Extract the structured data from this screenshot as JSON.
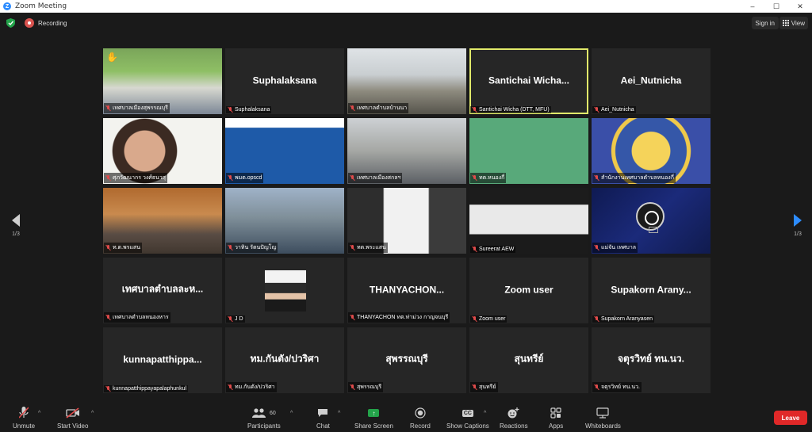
{
  "window": {
    "title": "Zoom Meeting",
    "minimize": "–",
    "maximize": "☐",
    "close": "✕"
  },
  "header": {
    "recording_label": "Recording",
    "signin_label": "Sign in",
    "view_label": "View"
  },
  "pagination": {
    "prev_page": "1/3",
    "next_page": "1/3"
  },
  "participants": [
    {
      "name": "",
      "label": "เทศบาลเมืองสุพรรณบุรี",
      "video": "vid-room1",
      "hand": "✋"
    },
    {
      "name": "Suphalaksana",
      "label": "Suphalaksana",
      "video": ""
    },
    {
      "name": "",
      "label": "เทศบาลตำบลบ้านนา",
      "video": "vid-room2"
    },
    {
      "name": "Santichai Wicha...",
      "label": "Santichai Wicha (DTT, MFU)",
      "video": "",
      "active": true
    },
    {
      "name": "Aei_Nutnicha",
      "label": "Aei_Nutnicha",
      "video": ""
    },
    {
      "name": "",
      "label": "ศุภวัฒนากร วงศ์ธนวสุ",
      "video": "vid-woman"
    },
    {
      "name": "",
      "label": "พมต.opscd",
      "video": "vid-slide"
    },
    {
      "name": "",
      "label": "เทศบาลเมืองสกลฯ",
      "video": "vid-room3"
    },
    {
      "name": "",
      "label": "ทต.หนองกี่",
      "video": "vid-green"
    },
    {
      "name": "",
      "label": "สำนักงานเทศบาลตำบลหนองกี่",
      "video": "vid-seal"
    },
    {
      "name": "",
      "label": "ท.ต.พรแสน",
      "video": "vid-woman2"
    },
    {
      "name": "",
      "label": "วาทิน รัตนปัญโญ",
      "video": "vid-hall"
    },
    {
      "name": "",
      "label": "ทต.พระแสน",
      "video": "vid-window"
    },
    {
      "name": "",
      "label": "Sureerat AEW",
      "video": "vid-car"
    },
    {
      "name": "",
      "label": "แม่จัน เทศบาล",
      "video": "vid-blue",
      "obs": true
    },
    {
      "name": "เทศบาลตำบลละห...",
      "label": "เทศบาลตำบลหนองหาร",
      "video": ""
    },
    {
      "name": "",
      "label": "J D",
      "video": "",
      "avatar": true
    },
    {
      "name": "THANYACHON...",
      "label": "THANYACHON ทต.ท่าม่วง กาญจนบุรี",
      "video": ""
    },
    {
      "name": "Zoom user",
      "label": "Zoom user",
      "video": ""
    },
    {
      "name": "Supakorn Arany...",
      "label": "Supakorn Aranyasen",
      "video": ""
    },
    {
      "name": "kunnapatthippa...",
      "label": "kunnapatthippayapalaphunkul",
      "video": ""
    },
    {
      "name": "ทม.กันตัง/ปวริศา",
      "label": "ทม.กันตัง/ปวริศา",
      "video": ""
    },
    {
      "name": "สุพรรณบุรี",
      "label": "สุพรรณบุรี",
      "video": ""
    },
    {
      "name": "สุนทรีย์",
      "label": "สุนทรีย์",
      "video": ""
    },
    {
      "name": "จตุรวิทย์ ทน.นว.",
      "label": "จตุรวิทย์ ทน.นว.",
      "video": ""
    }
  ],
  "toolbar": {
    "unmute": "Unmute",
    "start_video": "Start Video",
    "participants": "Participants",
    "participants_count": "60",
    "chat": "Chat",
    "share_screen": "Share Screen",
    "record": "Record",
    "show_captions": "Show Captions",
    "captions_icon_text": "CC",
    "reactions": "Reactions",
    "apps": "Apps",
    "whiteboards": "Whiteboards",
    "leave": "Leave"
  },
  "colors": {
    "accent": "#2d8cff",
    "active_speaker": "#e1ea6a",
    "share": "#23a34a",
    "leave": "#e02828"
  }
}
